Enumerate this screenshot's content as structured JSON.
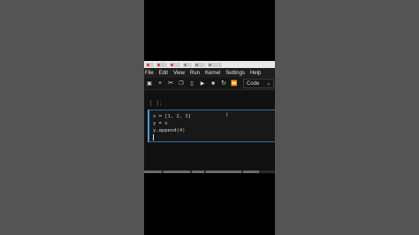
{
  "menubar": {
    "items": [
      "File",
      "Edit",
      "View",
      "Run",
      "Kernel",
      "Settings",
      "Help"
    ]
  },
  "toolbar": {
    "celltype": "Code"
  },
  "cell": {
    "prompt": "[ ]:",
    "lines": {
      "l1_var": "x",
      "l1_rest": " = [",
      "l1_vals": "1, 2, 3",
      "l1_end": "]",
      "l2_var": "y",
      "l2_rest": " = ",
      "l2_var2": "x",
      "l3_var": "y",
      "l3_method": ".append(",
      "l3_arg": "4",
      "l3_end": ")"
    }
  },
  "colors": {
    "background": "#545454",
    "accent_blue": "#4b9be0",
    "variable": "#9cdcfe",
    "number": "#b5cea8"
  }
}
